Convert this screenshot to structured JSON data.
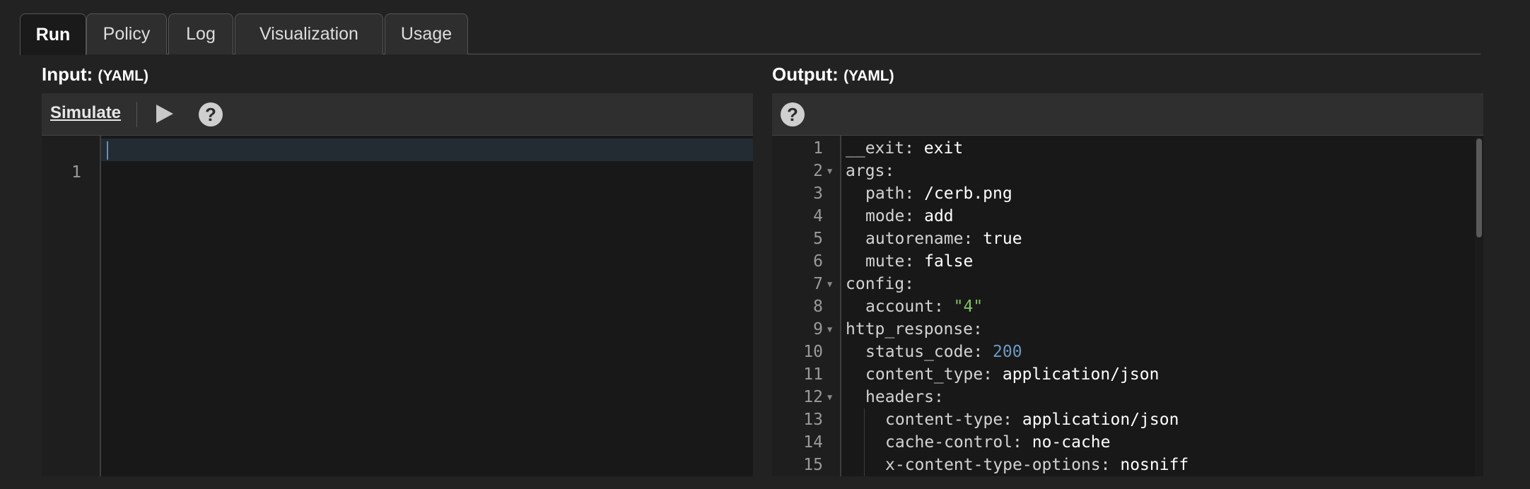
{
  "tabs": [
    {
      "label": "Run",
      "active": true
    },
    {
      "label": "Policy",
      "active": false
    },
    {
      "label": "Log",
      "active": false
    },
    {
      "label": "Visualization",
      "active": false
    },
    {
      "label": "Usage",
      "active": false
    }
  ],
  "input": {
    "title": "Input:",
    "format": "(YAML)",
    "simulate_label": "Simulate",
    "play_icon": "play-icon",
    "help_icon": "help-icon",
    "help_glyph": "?",
    "lines": [
      "1"
    ]
  },
  "output": {
    "title": "Output:",
    "format": "(YAML)",
    "help_icon": "help-icon",
    "help_glyph": "?",
    "lines": [
      {
        "num": "1",
        "key": "__exit",
        "sep": ": ",
        "val": "exit",
        "type": "v"
      },
      {
        "num": "2",
        "key": "args",
        "sep": ":",
        "val": "",
        "fold": true
      },
      {
        "num": "3",
        "key": "path",
        "sep": ": ",
        "val": "/cerb.png",
        "type": "v"
      },
      {
        "num": "4",
        "key": "mode",
        "sep": ": ",
        "val": "add",
        "type": "v"
      },
      {
        "num": "5",
        "key": "autorename",
        "sep": ": ",
        "val": "true",
        "type": "v"
      },
      {
        "num": "6",
        "key": "mute",
        "sep": ": ",
        "val": "false",
        "type": "v"
      },
      {
        "num": "7",
        "key": "config",
        "sep": ":",
        "val": "",
        "fold": true
      },
      {
        "num": "8",
        "key": "account",
        "sep": ": ",
        "val": "\"4\"",
        "type": "s"
      },
      {
        "num": "9",
        "key": "http_response",
        "sep": ":",
        "val": "",
        "fold": true
      },
      {
        "num": "10",
        "key": "status_code",
        "sep": ": ",
        "val": "200",
        "type": "n"
      },
      {
        "num": "11",
        "key": "content_type",
        "sep": ": ",
        "val": "application/json",
        "type": "v"
      },
      {
        "num": "12",
        "key": "headers",
        "sep": ":",
        "val": "",
        "fold": true
      },
      {
        "num": "13",
        "key": "content-type",
        "sep": ": ",
        "val": "application/json",
        "type": "v"
      },
      {
        "num": "14",
        "key": "cache-control",
        "sep": ": ",
        "val": "no-cache",
        "type": "v"
      },
      {
        "num": "15",
        "key": "x-content-type-options",
        "sep": ": ",
        "val": "nosniff",
        "type": "v"
      }
    ]
  },
  "colors": {
    "string": "#7ec262",
    "number": "#6d9ac2",
    "background": "#222222"
  }
}
